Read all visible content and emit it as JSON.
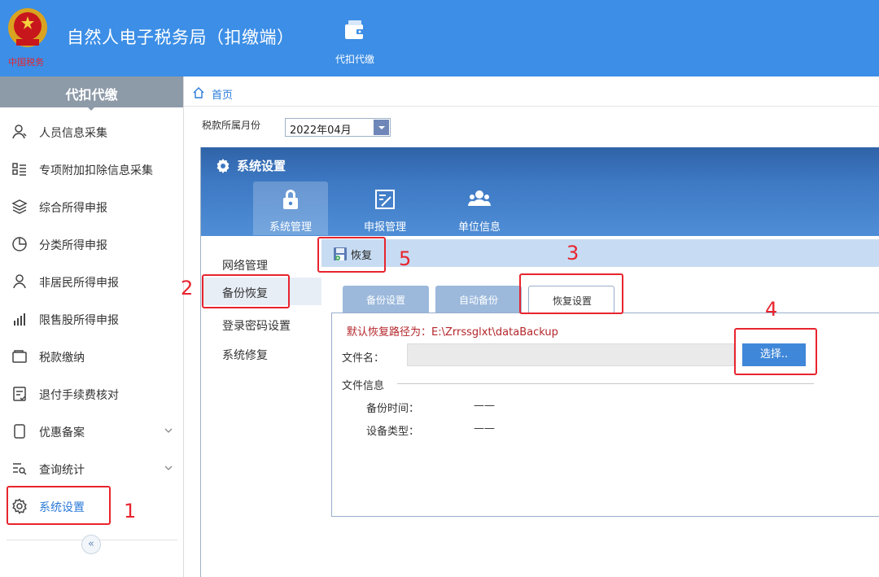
{
  "header": {
    "app_title": "自然人电子税务局（扣缴端）",
    "nav_item_label": "代扣代缴",
    "brand_color": "#3c8ee6"
  },
  "sidebar": {
    "title": "代扣代缴",
    "items": [
      {
        "label": "人员信息采集",
        "icon": "person-icon"
      },
      {
        "label": "专项附加扣除信息采集",
        "icon": "list-icon"
      },
      {
        "label": "综合所得申报",
        "icon": "layers-icon"
      },
      {
        "label": "分类所得申报",
        "icon": "pie-icon"
      },
      {
        "label": "非居民所得申报",
        "icon": "person-outline-icon"
      },
      {
        "label": "限售股所得申报",
        "icon": "bar-chart-icon"
      },
      {
        "label": "税款缴纳",
        "icon": "wallet-icon"
      },
      {
        "label": "退付手续费核对",
        "icon": "checklist-icon"
      },
      {
        "label": "优惠备案",
        "icon": "document-icon",
        "expandable": true
      },
      {
        "label": "查询统计",
        "icon": "search-list-icon",
        "expandable": true
      },
      {
        "label": "系统设置",
        "icon": "gear-icon",
        "active": true
      }
    ],
    "collapse_glyph": "«"
  },
  "breadcrumb": {
    "home": "首页"
  },
  "filter": {
    "tax_month_label": "税款所属月份",
    "tax_month_value": "2022年04月"
  },
  "dialog": {
    "title": "系统设置",
    "tabs": [
      {
        "label": "系统管理",
        "icon": "lock-icon",
        "active": true
      },
      {
        "label": "申报管理",
        "icon": "edit-doc-icon"
      },
      {
        "label": "单位信息",
        "icon": "group-icon"
      }
    ],
    "side_menu": [
      {
        "label": "网络管理"
      },
      {
        "label": "备份恢复",
        "active": true
      },
      {
        "label": "登录密码设置"
      },
      {
        "label": "系统修复"
      }
    ],
    "toolbar": {
      "restore_label": "恢复"
    },
    "panel_tabs": [
      {
        "label": "备份设置"
      },
      {
        "label": "自动备份"
      },
      {
        "label": "恢复设置",
        "active": true
      }
    ],
    "panel": {
      "default_path": "默认恢复路径为：E:\\Zrrssglxt\\dataBackup",
      "file_name_label": "文件名：",
      "file_name_value": "",
      "select_button": "选择..",
      "file_info_label": "文件信息",
      "backup_time_label": "备份时间：",
      "backup_time_value": "——",
      "device_type_label": "设备类型：",
      "device_type_value": "——"
    }
  },
  "annotations": {
    "steps": [
      "1",
      "2",
      "3",
      "4",
      "5"
    ],
    "color": "#e8242e"
  }
}
